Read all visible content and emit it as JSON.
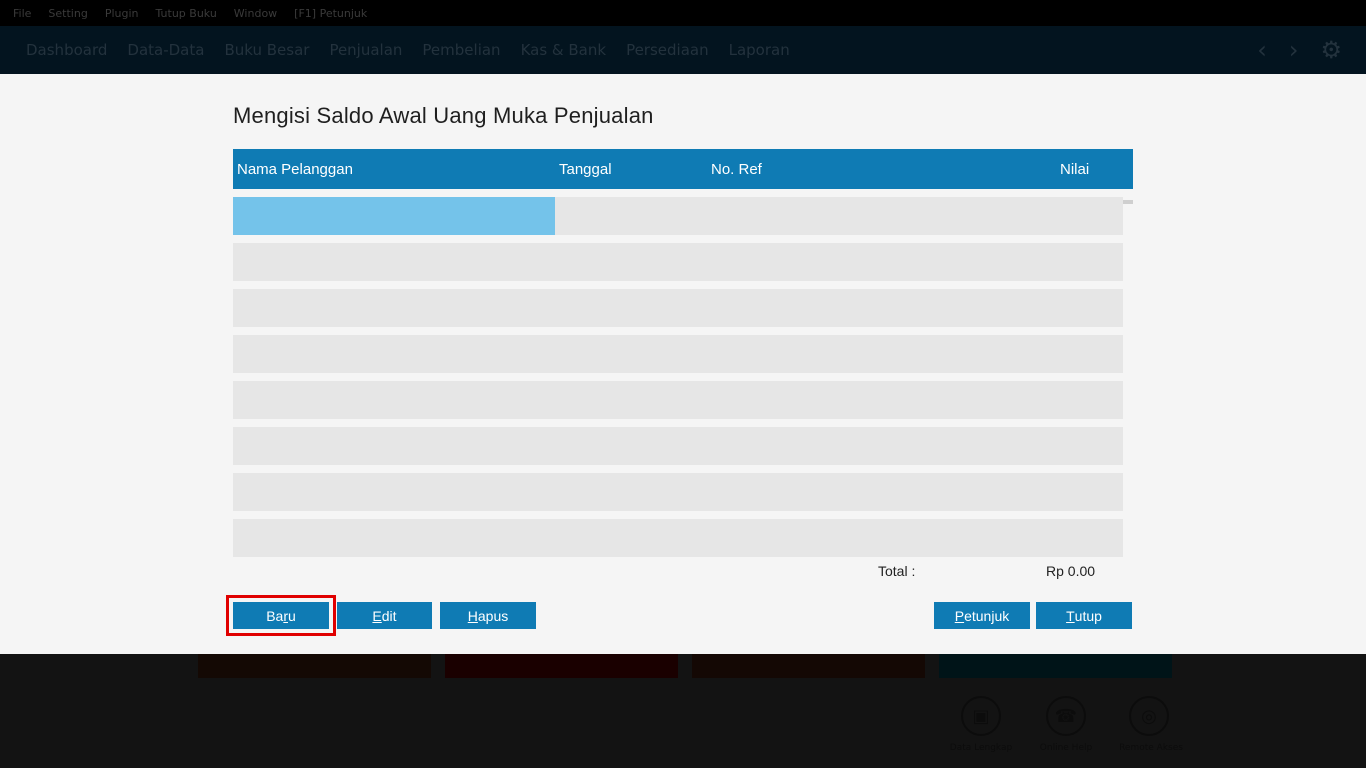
{
  "menubar": {
    "items": [
      "File",
      "Setting",
      "Plugin",
      "Tutup Buku",
      "Window",
      "[F1] Petunjuk"
    ]
  },
  "navbar": {
    "items": [
      "Dashboard",
      "Data-Data",
      "Buku Besar",
      "Penjualan",
      "Pembelian",
      "Kas & Bank",
      "Persediaan",
      "Laporan"
    ]
  },
  "background": {
    "shortcuts": [
      "Data Lengkap",
      "Online Help",
      "Remote Akses"
    ]
  },
  "dialog": {
    "title": "Mengisi Saldo Awal Uang Muka Penjualan",
    "columns": [
      "Nama Pelanggan",
      "Tanggal",
      "No. Ref",
      "Nilai"
    ],
    "rows": [
      {
        "nama": "",
        "tanggal": "",
        "ref": "",
        "nilai": ""
      },
      {
        "nama": "",
        "tanggal": "",
        "ref": "",
        "nilai": ""
      },
      {
        "nama": "",
        "tanggal": "",
        "ref": "",
        "nilai": ""
      },
      {
        "nama": "",
        "tanggal": "",
        "ref": "",
        "nilai": ""
      },
      {
        "nama": "",
        "tanggal": "",
        "ref": "",
        "nilai": ""
      },
      {
        "nama": "",
        "tanggal": "",
        "ref": "",
        "nilai": ""
      },
      {
        "nama": "",
        "tanggal": "",
        "ref": "",
        "nilai": ""
      },
      {
        "nama": "",
        "tanggal": "",
        "ref": "",
        "nilai": ""
      }
    ],
    "total_label": "Total :",
    "total_value": "Rp 0.00",
    "buttons": {
      "baru": {
        "pre": "Ba",
        "u": "r",
        "post": "u"
      },
      "edit": {
        "pre": "",
        "u": "E",
        "post": "dit"
      },
      "hapus": {
        "pre": "",
        "u": "H",
        "post": "apus"
      },
      "petunjuk": {
        "pre": "",
        "u": "P",
        "post": "etunjuk"
      },
      "tutup": {
        "pre": "",
        "u": "T",
        "post": "utup"
      }
    }
  },
  "colors": {
    "accent": "#0f7bb4",
    "selected_cell": "#74c3ea",
    "row_bg": "#e6e6e6",
    "highlight": "#e00000"
  }
}
